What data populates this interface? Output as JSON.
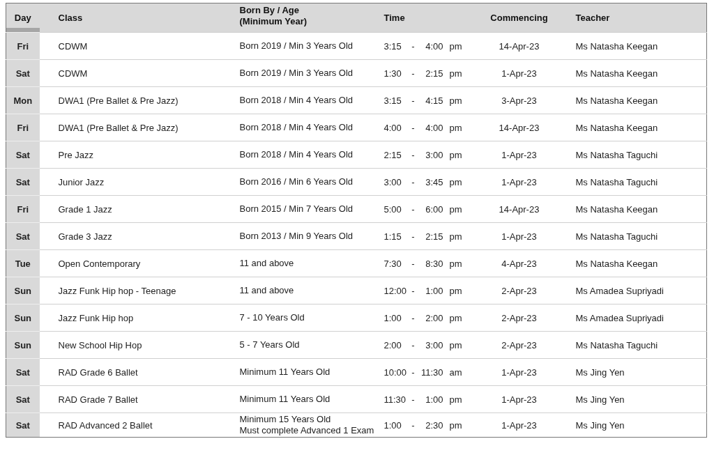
{
  "table": {
    "columns": [
      {
        "lines": [
          "Day"
        ]
      },
      {
        "lines": [
          "Class"
        ]
      },
      {
        "lines": [
          "Born By / Age",
          "(Minimum Year)"
        ]
      },
      {
        "lines": [
          "Time"
        ]
      },
      {
        "lines": [
          "Commencing"
        ]
      },
      {
        "lines": [
          "Teacher"
        ]
      }
    ],
    "rows": [
      {
        "day": "Fri",
        "class": "CDWM",
        "age": [
          "Born 2019 / Min 3 Years Old"
        ],
        "time": {
          "start": "3:15",
          "sep": "-",
          "end": "4:00",
          "period": "pm"
        },
        "commencing": "14-Apr-23",
        "teacher": "Ms Natasha Keegan"
      },
      {
        "day": "Sat",
        "class": "CDWM",
        "age": [
          "Born 2019 / Min 3 Years Old"
        ],
        "time": {
          "start": "1:30",
          "sep": "-",
          "end": "2:15",
          "period": "pm"
        },
        "commencing": "1-Apr-23",
        "teacher": "Ms Natasha Keegan"
      },
      {
        "day": "Mon",
        "class": "DWA1 (Pre Ballet & Pre Jazz)",
        "age": [
          "Born 2018 / Min 4 Years Old"
        ],
        "time": {
          "start": "3:15",
          "sep": "-",
          "end": "4:15",
          "period": "pm"
        },
        "commencing": "3-Apr-23",
        "teacher": "Ms Natasha Keegan"
      },
      {
        "day": "Fri",
        "class": "DWA1 (Pre Ballet & Pre Jazz)",
        "age": [
          "Born 2018 / Min 4 Years Old"
        ],
        "time": {
          "start": "4:00",
          "sep": "-",
          "end": "4:00",
          "period": "pm"
        },
        "commencing": "14-Apr-23",
        "teacher": "Ms Natasha Keegan"
      },
      {
        "day": "Sat",
        "class": "Pre Jazz",
        "age": [
          "Born 2018 / Min 4 Years Old"
        ],
        "time": {
          "start": "2:15",
          "sep": "-",
          "end": "3:00",
          "period": "pm"
        },
        "commencing": "1-Apr-23",
        "teacher": "Ms Natasha Taguchi"
      },
      {
        "day": "Sat",
        "class": "Junior Jazz",
        "age": [
          "Born 2016 / Min 6 Years Old"
        ],
        "time": {
          "start": "3:00",
          "sep": "-",
          "end": "3:45",
          "period": "pm"
        },
        "commencing": "1-Apr-23",
        "teacher": "Ms Natasha Taguchi"
      },
      {
        "day": "Fri",
        "class": "Grade 1 Jazz",
        "age": [
          "Born 2015 / Min 7 Years Old"
        ],
        "time": {
          "start": "5:00",
          "sep": "-",
          "end": "6:00",
          "period": "pm"
        },
        "commencing": "14-Apr-23",
        "teacher": "Ms Natasha Keegan"
      },
      {
        "day": "Sat",
        "class": "Grade 3 Jazz",
        "age": [
          "Born 2013 / Min 9 Years Old"
        ],
        "time": {
          "start": "1:15",
          "sep": "-",
          "end": "2:15",
          "period": "pm"
        },
        "commencing": "1-Apr-23",
        "teacher": "Ms Natasha Taguchi"
      },
      {
        "day": "Tue",
        "class": "Open Contemporary",
        "age": [
          "11 and above"
        ],
        "time": {
          "start": "7:30",
          "sep": "-",
          "end": "8:30",
          "period": "pm"
        },
        "commencing": "4-Apr-23",
        "teacher": "Ms Natasha Keegan"
      },
      {
        "day": "Sun",
        "class": "Jazz Funk Hip hop - Teenage",
        "age": [
          "11 and above"
        ],
        "time": {
          "start": "12:00",
          "sep": "-",
          "end": "1:00",
          "period": "pm"
        },
        "commencing": "2-Apr-23",
        "teacher": "Ms Amadea Supriyadi"
      },
      {
        "day": "Sun",
        "class": "Jazz Funk Hip hop",
        "age": [
          "7 - 10 Years Old"
        ],
        "time": {
          "start": "1:00",
          "sep": "-",
          "end": "2:00",
          "period": "pm"
        },
        "commencing": "2-Apr-23",
        "teacher": "Ms Amadea Supriyadi"
      },
      {
        "day": "Sun",
        "class": "New School Hip Hop",
        "age": [
          "5 - 7 Years Old"
        ],
        "time": {
          "start": "2:00",
          "sep": "-",
          "end": "3:00",
          "period": "pm"
        },
        "commencing": "2-Apr-23",
        "teacher": "Ms Natasha Taguchi"
      },
      {
        "day": "Sat",
        "class": "RAD Grade 6 Ballet",
        "age": [
          "Minimum 11 Years Old"
        ],
        "time": {
          "start": "10:00",
          "sep": "-",
          "end": "11:30",
          "period": "am"
        },
        "commencing": "1-Apr-23",
        "teacher": "Ms Jing Yen"
      },
      {
        "day": "Sat",
        "class": "RAD Grade 7 Ballet",
        "age": [
          "Minimum 11 Years Old"
        ],
        "time": {
          "start": "11:30",
          "sep": "-",
          "end": "1:00",
          "period": "pm"
        },
        "commencing": "1-Apr-23",
        "teacher": "Ms Jing Yen"
      },
      {
        "day": "Sat",
        "class": "RAD Advanced 2 Ballet",
        "age": [
          "Minimum 15 Years Old",
          "Must complete Advanced 1 Exam"
        ],
        "time": {
          "start": "1:00",
          "sep": "-",
          "end": "2:30",
          "period": "pm"
        },
        "commencing": "1-Apr-23",
        "teacher": "Ms Jing Yen"
      }
    ]
  }
}
